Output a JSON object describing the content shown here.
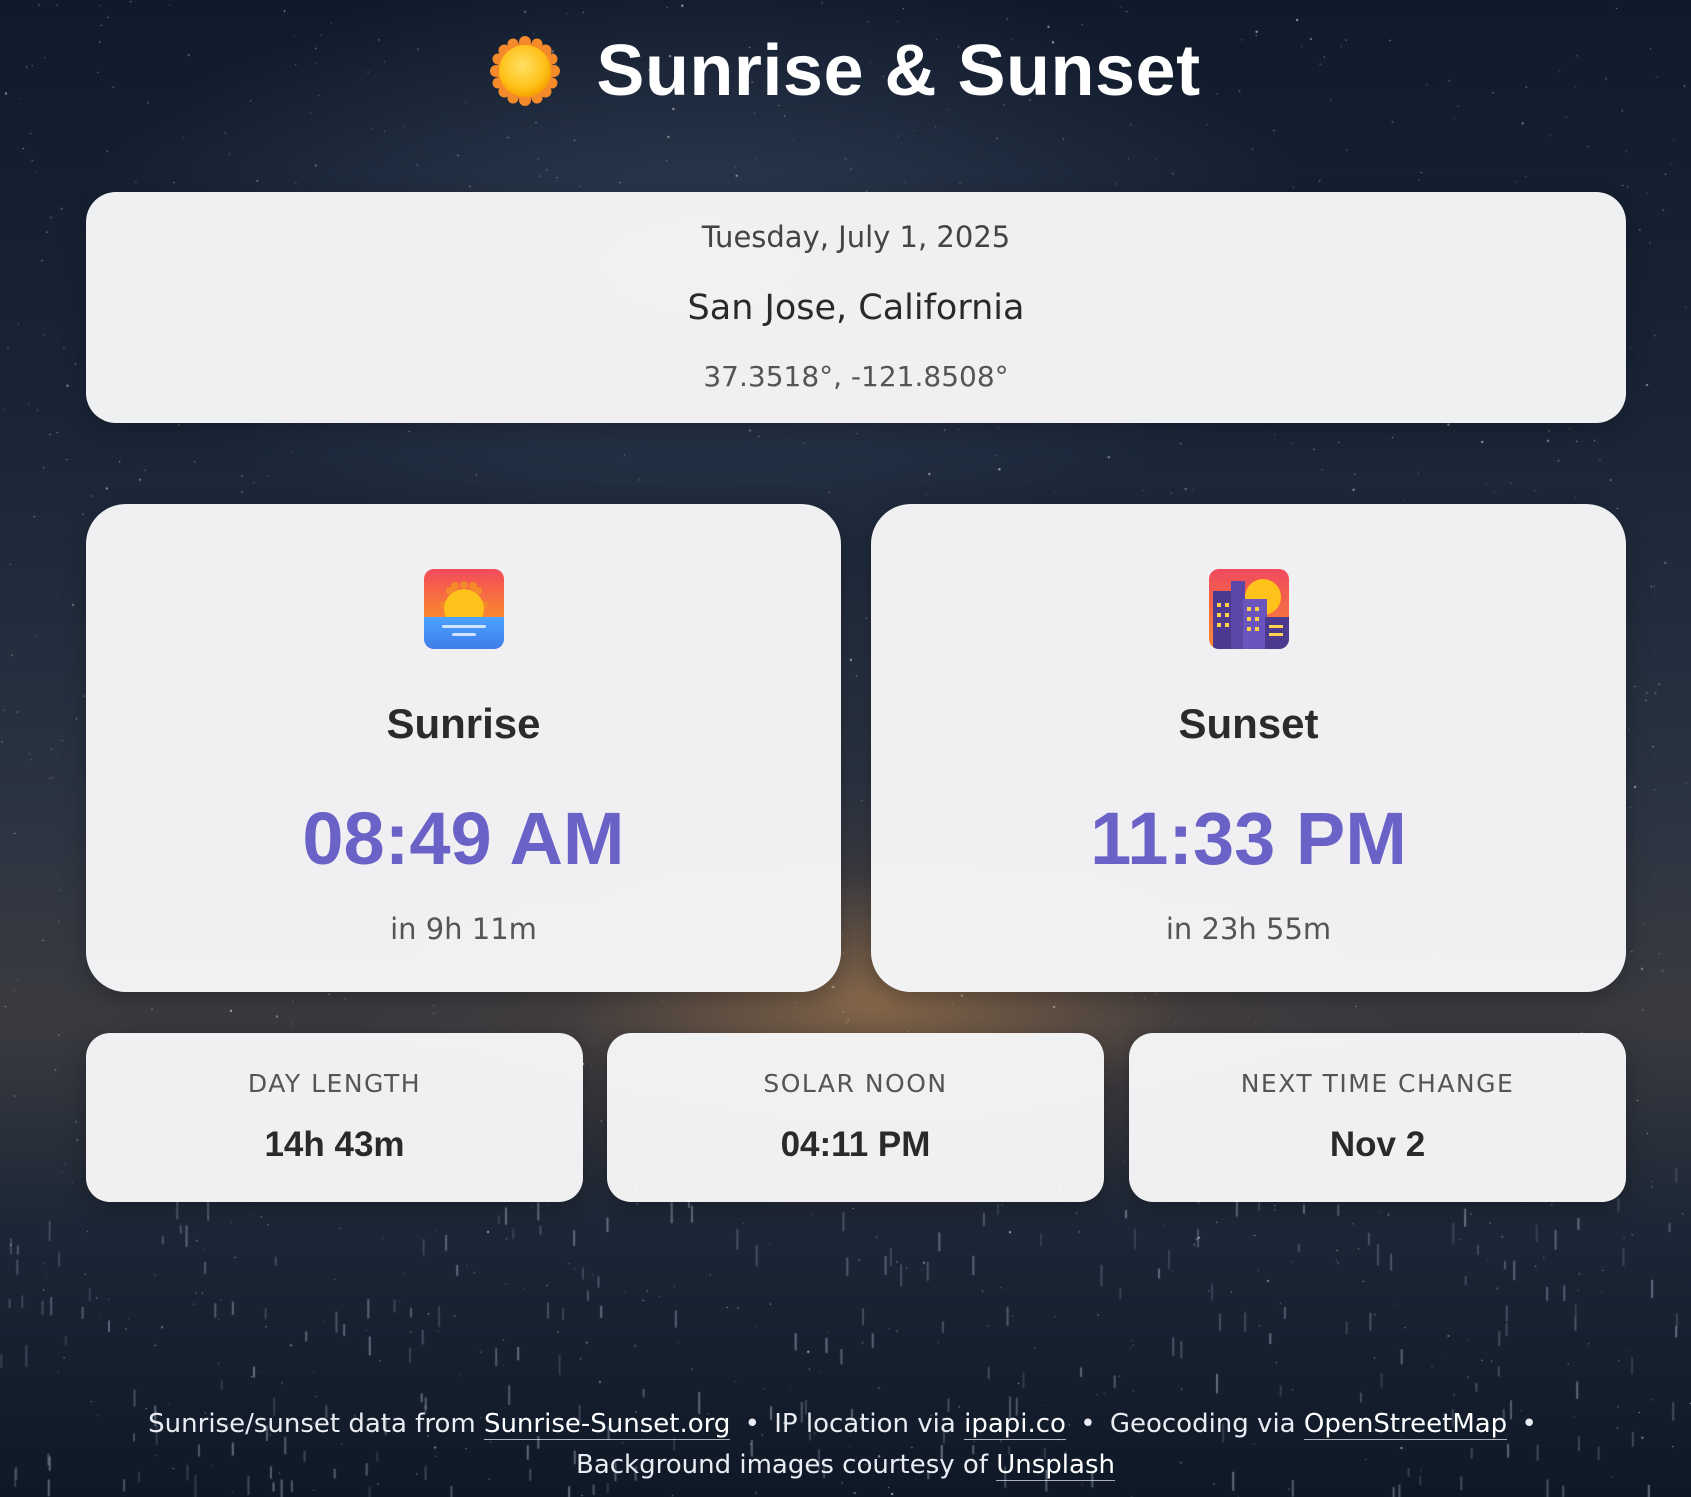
{
  "app": {
    "title": "Sunrise & Sunset",
    "title_icon": "sun-icon"
  },
  "info": {
    "date": "Tuesday, July 1, 2025",
    "city": "San Jose, California",
    "coords": "37.3518°, -121.8508°"
  },
  "sunrise": {
    "icon": "sunrise-icon",
    "label": "Sunrise",
    "time": "08:49 AM",
    "countdown": "in 9h 11m"
  },
  "sunset": {
    "icon": "sunset-city-icon",
    "label": "Sunset",
    "time": "11:33 PM",
    "countdown": "in 23h 55m"
  },
  "stats": {
    "day_length": {
      "label": "DAY LENGTH",
      "value": "14h 43m"
    },
    "solar_noon": {
      "label": "SOLAR NOON",
      "value": "04:11 PM"
    },
    "next_time_change": {
      "label": "NEXT TIME CHANGE",
      "value": "Nov 2"
    }
  },
  "footer": {
    "text1": "Sunrise/sunset data from ",
    "link1": "Sunrise-Sunset.org",
    "sep": "•",
    "text2": "IP location via ",
    "link2": "ipapi.co",
    "text3": "Geocoding via ",
    "link3": "OpenStreetMap",
    "text4": "Background images courtesy of ",
    "link4": "Unsplash"
  },
  "colors": {
    "accent_time": "#6b62c7",
    "card_bg": "#f7f7f8"
  }
}
